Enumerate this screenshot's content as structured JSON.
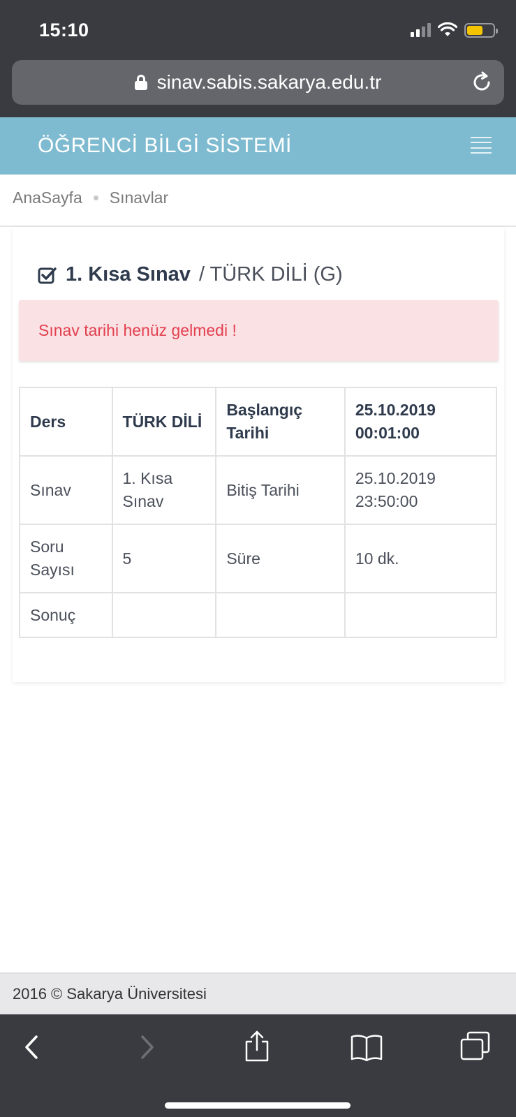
{
  "status_bar": {
    "time": "15:10"
  },
  "browser": {
    "url": "sinav.sabis.sakarya.edu.tr"
  },
  "header": {
    "title": "ÖĞRENCİ BİLGİ SİSTEMİ"
  },
  "breadcrumb": {
    "items": [
      "AnaSayfa",
      "Sınavlar"
    ]
  },
  "exam": {
    "title_bold": "1. Kısa Sınav",
    "title_rest": "/ TÜRK DİLİ (G)",
    "alert": "Sınav tarihi henüz gelmedi !",
    "table": [
      [
        "Ders",
        "TÜRK DİLİ",
        "Başlangıç Tarihi",
        "25.10.2019 00:01:00"
      ],
      [
        "Sınav",
        "1. Kısa Sınav",
        "Bitiş Tarihi",
        "25.10.2019 23:50:00"
      ],
      [
        "Soru Sayısı",
        "5",
        "Süre",
        "10 dk."
      ],
      [
        "Sonuç",
        "",
        "",
        ""
      ]
    ]
  },
  "footer": {
    "text": "2016 © Sakarya Üniversitesi"
  },
  "icons": {
    "lock": "lock-icon",
    "reload": "reload-icon",
    "menu": "hamburger-icon",
    "check": "check-square-icon",
    "toolbar": [
      "back-icon",
      "forward-icon",
      "share-icon",
      "bookmarks-icon",
      "tabs-icon"
    ]
  },
  "colors": {
    "header": "#7fbbd0",
    "alert_bg": "#fae1e3",
    "alert_text": "#e24050",
    "battery": "#f5c400"
  }
}
